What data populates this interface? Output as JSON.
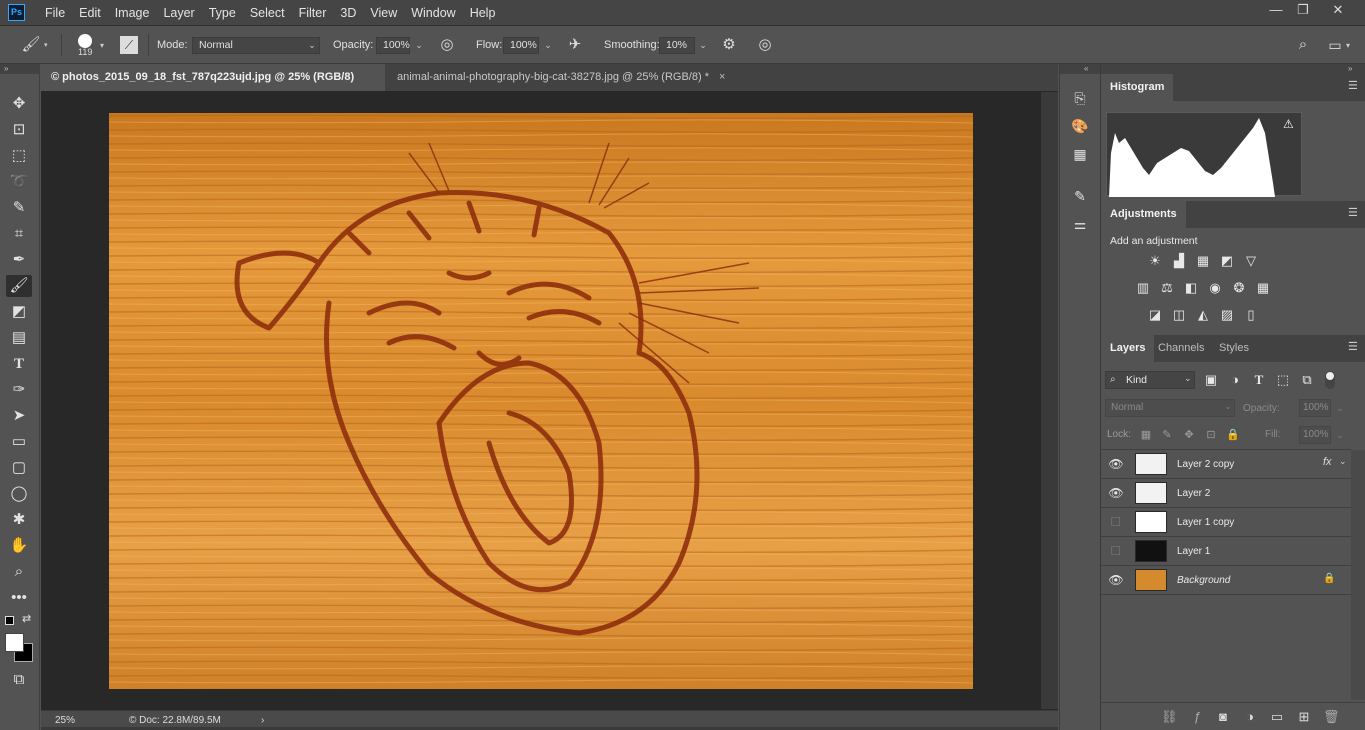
{
  "app": {
    "logo": "Ps"
  },
  "menu": {
    "items": [
      "File",
      "Edit",
      "Image",
      "Layer",
      "Type",
      "Select",
      "Filter",
      "3D",
      "View",
      "Window",
      "Help"
    ]
  },
  "window_controls": {
    "minimize": "—",
    "restore": "❐",
    "close": "✕"
  },
  "options": {
    "brush_size": "119",
    "mode_label": "Mode:",
    "mode_value": "Normal",
    "opacity_label": "Opacity:",
    "opacity_value": "100%",
    "flow_label": "Flow:",
    "flow_value": "100%",
    "smoothing_label": "Smoothing:",
    "smoothing_value": "10%"
  },
  "tabs": [
    {
      "label": "© photos_2015_09_18_fst_787q223ujd.jpg @ 25% (RGB/8) *",
      "close": "×",
      "active": true
    },
    {
      "label": "animal-animal-photography-big-cat-38278.jpg @ 25% (RGB/8) *",
      "close": "×",
      "active": false
    }
  ],
  "status": {
    "zoom": "25%",
    "doc": "© Doc: 22.8M/89.5M",
    "arrow": "›"
  },
  "panels": {
    "histogram": {
      "tab": "Histogram"
    },
    "adjustments": {
      "tab": "Adjustments",
      "add_label": "Add an adjustment"
    },
    "layers": {
      "tabs": [
        "Layers",
        "Channels",
        "Styles"
      ],
      "filter_kind": "Kind",
      "blend_mode": "Normal",
      "opacity_label": "Opacity:",
      "opacity_value": "100%",
      "lock_label": "Lock:",
      "fill_label": "Fill:",
      "fill_value": "100%",
      "fx_label": "fx",
      "rows": [
        {
          "name": "Layer 2 copy",
          "visible": true,
          "fx": true
        },
        {
          "name": "Layer 2",
          "visible": true
        },
        {
          "name": "Layer 1 copy",
          "visible": false
        },
        {
          "name": "Layer 1",
          "visible": false
        },
        {
          "name": "Background",
          "visible": true,
          "locked": true
        }
      ]
    }
  },
  "colors": {
    "accent": "#31a8ff",
    "wood": "#d68a2e",
    "burn": "#8a2a0a"
  }
}
